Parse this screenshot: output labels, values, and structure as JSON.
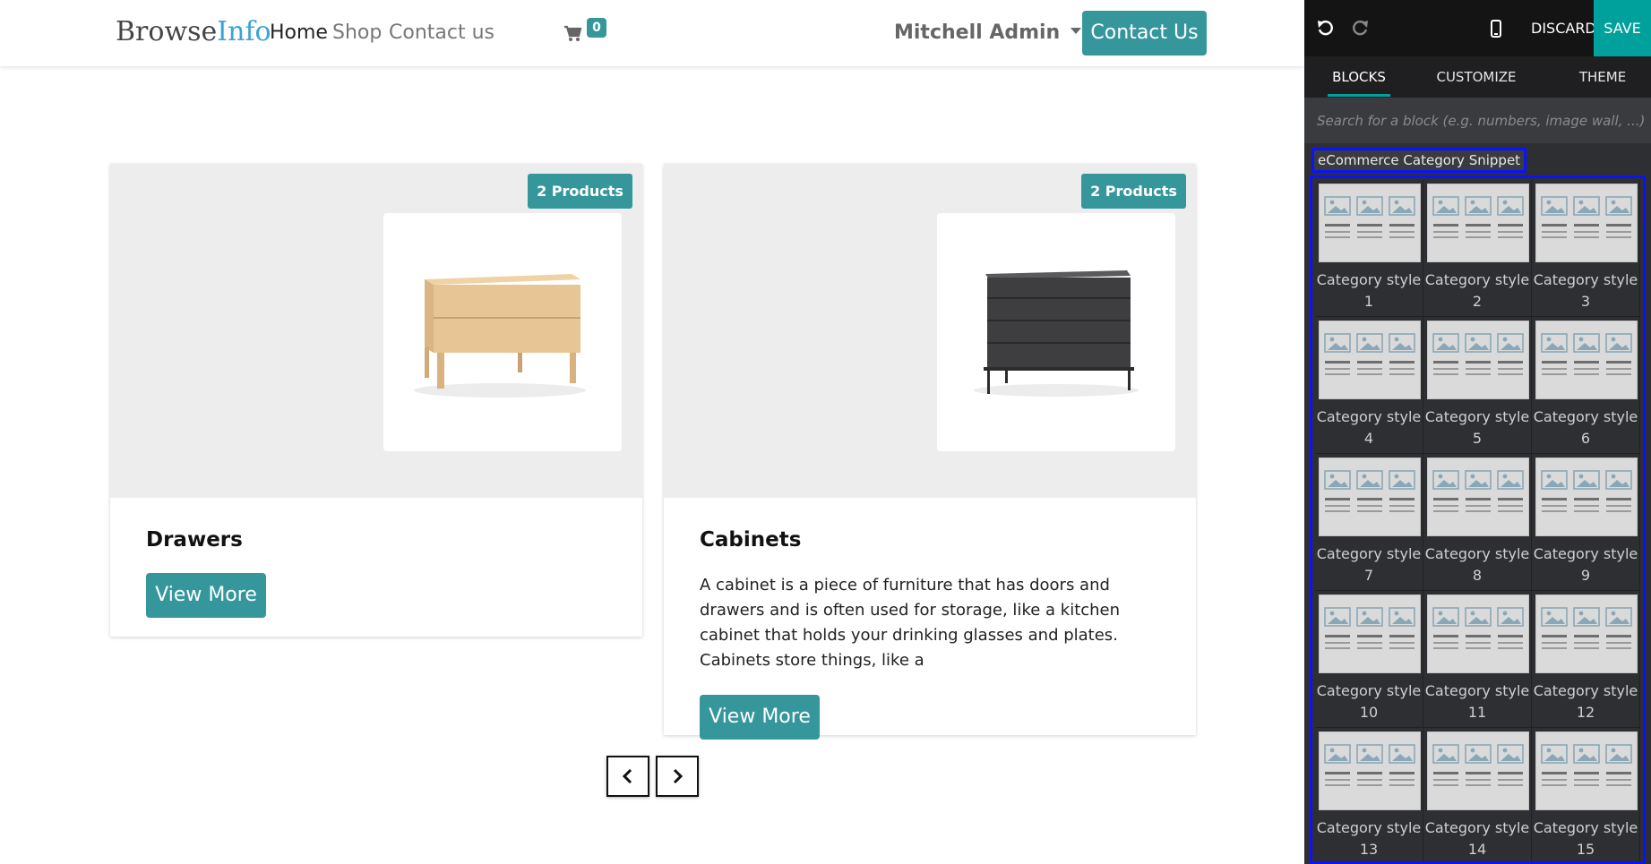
{
  "nav": {
    "logo_browse": "Browse",
    "logo_info": "Info",
    "links": [
      "Home",
      "Shop",
      "Contact us"
    ],
    "cart_count": "0",
    "user": "Mitchell Admin",
    "contact_button": "Contact Us"
  },
  "cards": [
    {
      "badge": "2 Products",
      "title": "Drawers",
      "description": "",
      "button": "View More"
    },
    {
      "badge": "2 Products",
      "title": "Cabinets",
      "description": "A cabinet is a piece of furniture that has doors and drawers and is often used for storage, like a kitchen cabinet that holds your drinking glasses and plates. Cabinets store things, like a",
      "button": "View More"
    }
  ],
  "editor": {
    "discard": "DISCARD",
    "save": "SAVE",
    "tabs": [
      "BLOCKS",
      "CUSTOMIZE",
      "THEME"
    ],
    "search_placeholder": "Search for a block (e.g. numbers, image wall, ...)",
    "section_title": "eCommerce Category Snippet",
    "snippet_prefix": "Category style",
    "snippets": [
      "1",
      "2",
      "3",
      "4",
      "5",
      "6",
      "7",
      "8",
      "9",
      "10",
      "11",
      "12",
      "13",
      "14",
      "15"
    ]
  },
  "colors": {
    "accent": "#35979c",
    "save": "#00a09d",
    "highlight": "#0a12ff"
  }
}
